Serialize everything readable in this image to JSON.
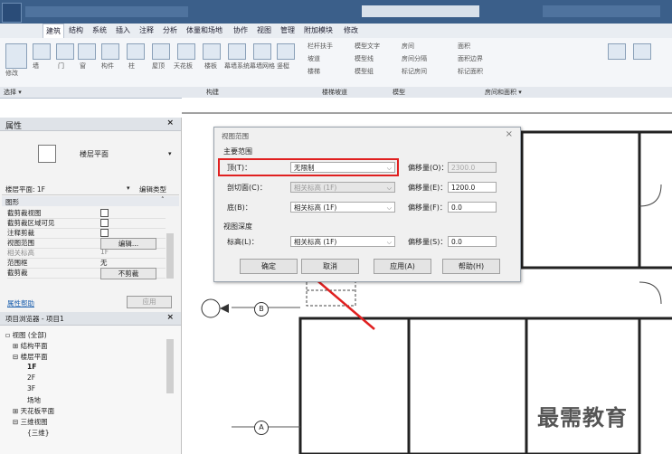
{
  "tabs": [
    "建筑",
    "结构",
    "系统",
    "插入",
    "注释",
    "分析",
    "体量和场地",
    "协作",
    "视图",
    "管理",
    "附加模块",
    "修改"
  ],
  "panels": [
    "选择 ▾",
    "构建",
    "楼梯坡道",
    "模型",
    "房间和面积 ▾"
  ],
  "ribbon_labels": [
    "修改",
    "墙",
    "门",
    "窗",
    "构件",
    "柱",
    "屋顶",
    "天花板",
    "楼板",
    "幕墙系统",
    "幕墙网格",
    "竖梃",
    "栏杆扶手",
    "坡道",
    "楼梯",
    "模型文字",
    "模型线",
    "模型组",
    "房间",
    "房间分隔",
    "标记房间",
    "面积",
    "面积边界",
    "标记面积"
  ],
  "properties": {
    "title": "属性",
    "close": "×",
    "type_name": "楼层平面",
    "selector": "楼层平面: 1F",
    "edit_type": "编辑类型",
    "section": "图形",
    "rows": [
      {
        "k": "截剪裁视图",
        "v": ""
      },
      {
        "k": "截剪裁区域可见",
        "v": ""
      },
      {
        "k": "注释剪裁",
        "v": ""
      },
      {
        "k": "视图范围",
        "v": "编辑..."
      },
      {
        "k": "相关标高",
        "v": "1F"
      },
      {
        "k": "范围框",
        "v": "无"
      },
      {
        "k": "截剪裁",
        "v": "不剪裁"
      }
    ],
    "help_link": "属性帮助",
    "apply": "应用"
  },
  "browser": {
    "title": "项目浏览器 - 项目1",
    "close": "×",
    "items": [
      "视图 (全部)",
      "结构平面",
      "楼层平面",
      "1F",
      "2F",
      "3F",
      "场地",
      "天花板平面",
      "三维视图",
      "{三维}"
    ]
  },
  "dialog": {
    "title": "视图范围",
    "close": "×",
    "primary_range": "主要范围",
    "top_label": "顶(T)：",
    "top_value": "无限制",
    "top_offset_label": "偏移量(O)：",
    "top_offset_value": "2300.0",
    "cut_label": "剖切面(C)：",
    "cut_value": "相关标高 (1F)",
    "cut_offset_label": "偏移量(E)：",
    "cut_offset_value": "1200.0",
    "bottom_label": "底(B)：",
    "bottom_value": "相关标高 (1F)",
    "bottom_offset_label": "偏移量(F)：",
    "bottom_offset_value": "0.0",
    "depth_section": "视图深度",
    "level_label": "标高(L)：",
    "level_value": "相关标高 (1F)",
    "level_offset_label": "偏移量(S)：",
    "level_offset_value": "0.0",
    "ok": "确定",
    "cancel": "取消",
    "apply": "应用(A)",
    "help": "帮助(H)"
  },
  "grid_bubbles": [
    "B",
    "A"
  ],
  "watermark": "最需教育",
  "colors": {
    "highlight": "#e02020",
    "ribbon_blue": "#3b5f8a"
  }
}
